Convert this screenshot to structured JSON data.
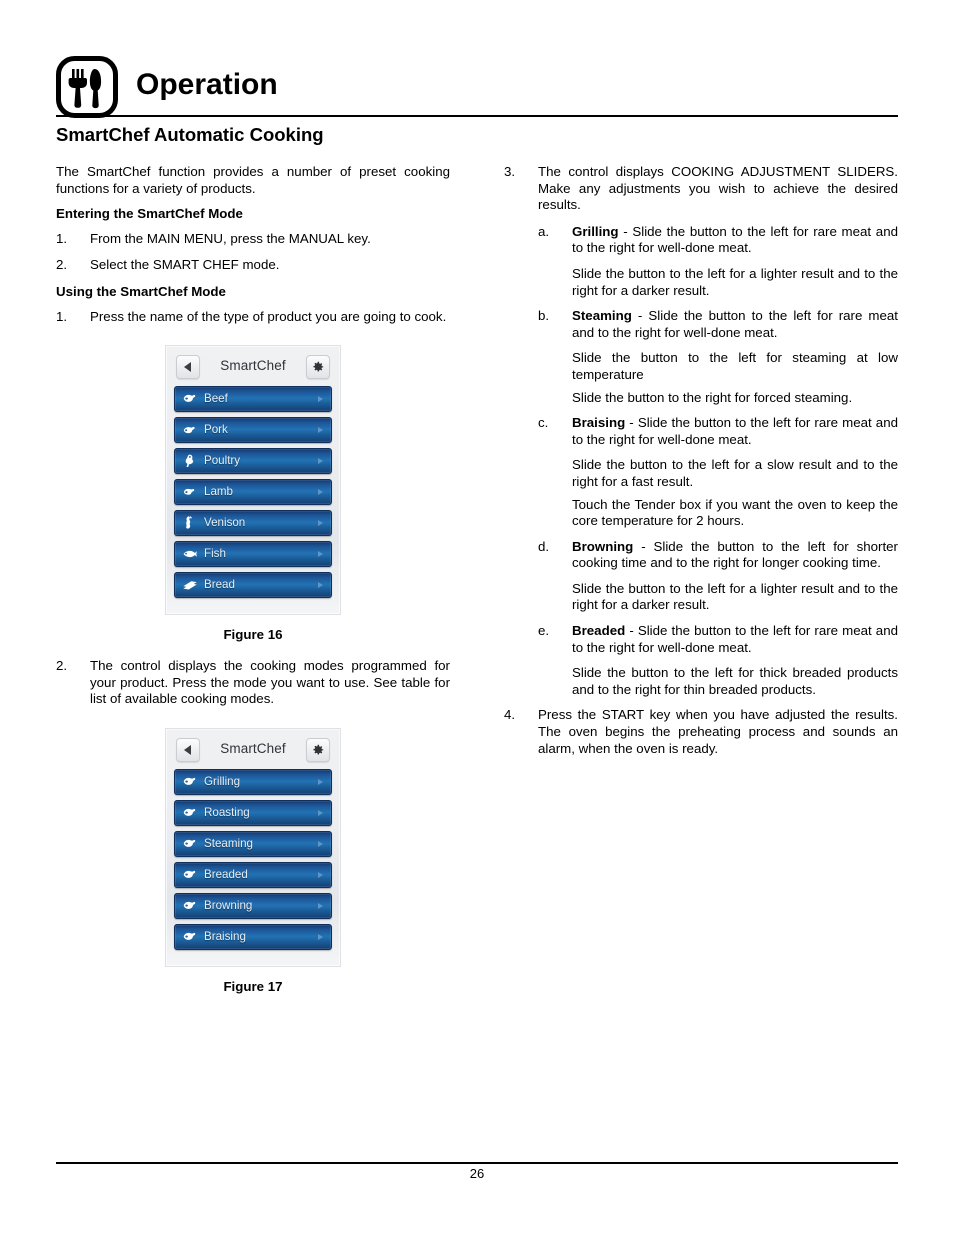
{
  "header": {
    "icon": "fork-knife-icon",
    "title": "Operation"
  },
  "section_title": "SmartChef Automatic Cooking",
  "left_column": {
    "intro": "The SmartChef function provides a number of preset cooking functions for a variety of products.",
    "subhead_entering": "Entering the SmartChef Mode",
    "entering_steps": [
      {
        "marker": "1.",
        "text": "From the MAIN MENU, press the MANUAL key."
      },
      {
        "marker": "2.",
        "text": "Select the SMART CHEF mode."
      }
    ],
    "subhead_using": "Using the SmartChef Mode",
    "step1": {
      "marker": "1.",
      "text": "Press the name of the type of product you are going to cook."
    },
    "figure16": {
      "caption": "Figure 16",
      "screen_title": "SmartChef",
      "back_icon": "back-arrow-icon",
      "gear_icon": "gear-icon",
      "items": [
        {
          "label": "Beef",
          "icon": "beef-icon"
        },
        {
          "label": "Pork",
          "icon": "pork-icon"
        },
        {
          "label": "Poultry",
          "icon": "poultry-icon"
        },
        {
          "label": "Lamb",
          "icon": "lamb-icon"
        },
        {
          "label": "Venison",
          "icon": "venison-icon"
        },
        {
          "label": "Fish",
          "icon": "fish-icon"
        },
        {
          "label": "Bread",
          "icon": "bread-icon"
        }
      ]
    },
    "step2": {
      "marker": "2.",
      "text": "The control displays the cooking modes programmed for your product. Press the mode you want to use. See table for list of available cooking modes."
    },
    "figure17": {
      "caption": "Figure 17",
      "screen_title": "SmartChef",
      "back_icon": "back-arrow-icon",
      "gear_icon": "gear-icon",
      "items": [
        {
          "label": "Grilling",
          "icon": "beef-icon"
        },
        {
          "label": "Roasting",
          "icon": "beef-icon"
        },
        {
          "label": "Steaming",
          "icon": "beef-icon"
        },
        {
          "label": "Breaded",
          "icon": "beef-icon"
        },
        {
          "label": "Browning",
          "icon": "beef-icon"
        },
        {
          "label": "Braising",
          "icon": "beef-icon"
        }
      ]
    }
  },
  "right_column": {
    "step3": {
      "marker": "3.",
      "text": "The control displays COOKING ADJUSTMENT SLIDERS. Make any adjustments you wish to achieve the desired results."
    },
    "sub_items": [
      {
        "marker": "a.",
        "term": "Grilling",
        "rest": " - Slide the button to the left for rare meat and to the right for well-done meat.",
        "paras": [
          "Slide the button to the left for a lighter result and to the right for a darker result."
        ]
      },
      {
        "marker": "b.",
        "term": "Steaming",
        "rest": " - Slide the button to the left for rare meat and to the right for well-done meat.",
        "paras": [
          "Slide the button to the left for steaming at low temperature",
          "Slide the button to the right for forced steaming."
        ]
      },
      {
        "marker": "c.",
        "term": "Braising",
        "rest": " - Slide the button to the left for rare meat and to the right for well-done meat.",
        "paras": [
          "Slide the button to the left for a slow result and to the right for a fast result.",
          "Touch the Tender box if you want the oven to keep the core temperature for 2 hours."
        ]
      },
      {
        "marker": "d.",
        "term": "Browning",
        "rest": " - Slide the button to the left for shorter cooking time and to the right for longer cooking time.",
        "paras": [
          "Slide the button to the left for a lighter result and to the right for a darker result."
        ]
      },
      {
        "marker": "e.",
        "term": "Breaded",
        "rest": " - Slide the button to the left for rare meat and to the right for well-done meat.",
        "paras": [
          "Slide the button to the left for thick breaded products and to the right for thin breaded products."
        ]
      }
    ],
    "step4": {
      "marker": "4.",
      "text": "Press the START key when you have adjusted the results. The oven begins the preheating process and sounds an alarm, when the oven is ready."
    }
  },
  "footer": {
    "page_number": "26"
  },
  "colors": {
    "button_blue_top": "#14396f",
    "button_blue_mid": "#2272b4",
    "button_blue_bottom": "#153f74",
    "panel_gray": "#eceef1",
    "text_black": "#000000"
  }
}
